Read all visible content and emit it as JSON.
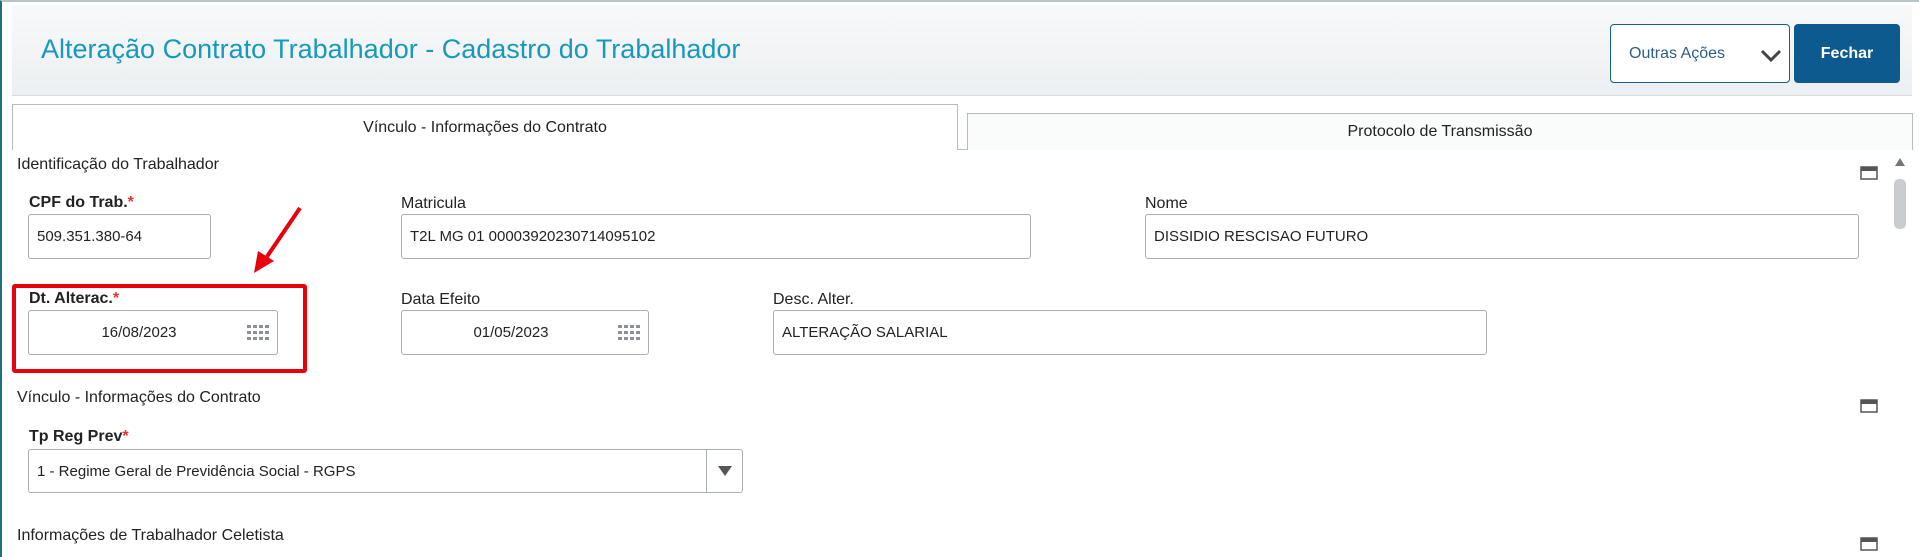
{
  "header": {
    "title": "Alteração Contrato Trabalhador - Cadastro do Trabalhador",
    "more_actions_label": "Outras Ações",
    "close_label": "Fechar"
  },
  "tabs": [
    {
      "label": "Vínculo - Informações do Contrato",
      "active": true
    },
    {
      "label": "Protocolo de Transmissão",
      "active": false
    }
  ],
  "section_identificacao": {
    "title": "Identificação do Trabalhador",
    "cpf": {
      "label": "CPF do Trab.",
      "required_mark": "*",
      "value": "509.351.380-64"
    },
    "matricula": {
      "label": "Matricula",
      "value": "T2L MG 01 00003920230714095102"
    },
    "nome": {
      "label": "Nome",
      "value": "DISSIDIO RESCISAO FUTURO"
    },
    "dt_alterac": {
      "label": "Dt. Alterac.",
      "required_mark": "*",
      "value": "16/08/2023"
    },
    "data_efeito": {
      "label": "Data Efeito",
      "value": "01/05/2023"
    },
    "desc_alter": {
      "label": "Desc. Alter.",
      "value": "ALTERAÇÃO SALARIAL"
    }
  },
  "section_vinculo": {
    "title": "Vínculo - Informações do Contrato",
    "tp_reg_prev": {
      "label": "Tp Reg Prev",
      "required_mark": "*",
      "value": "1 - Regime Geral de Previdência Social - RGPS"
    }
  },
  "section_celetista": {
    "title": "Informações de Trabalhador Celetista"
  },
  "colors": {
    "title": "#1799bf",
    "primary_button": "#0d5a8f",
    "highlight": "#e8000b",
    "required": "#e32"
  },
  "icons": [
    "chevron-down-icon",
    "calendar-icon",
    "collapse-icon",
    "dropdown-arrow-icon",
    "scroll-up-icon",
    "annotation-arrow"
  ]
}
